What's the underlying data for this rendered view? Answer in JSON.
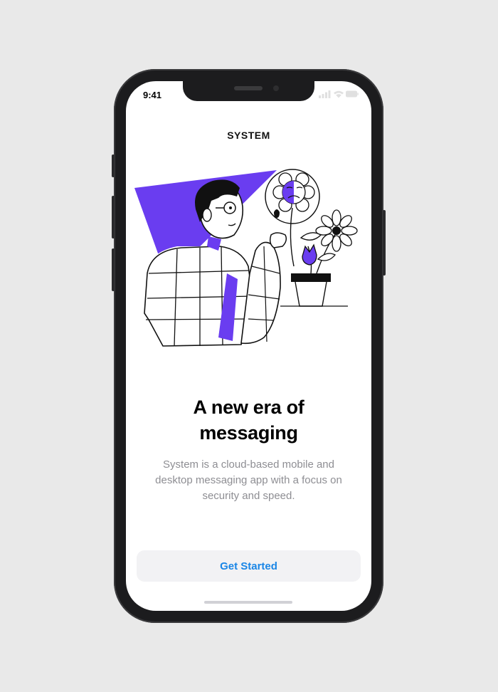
{
  "status_bar": {
    "time": "9:41"
  },
  "app": {
    "title": "SYSTEM"
  },
  "onboarding": {
    "headline_line1": "A new era of",
    "headline_line2": "messaging",
    "description_line1": "System is a cloud-based mobile and",
    "description_line2": "desktop messaging app with a focus on",
    "description_line3": "security and speed.",
    "cta_label": "Get Started"
  },
  "colors": {
    "accent": "#6a3df0",
    "link": "#1a86e6",
    "button_bg": "#f2f2f4",
    "muted_text": "#8e8e93"
  },
  "icons": [
    "signal-icon",
    "wifi-icon",
    "battery-icon"
  ]
}
